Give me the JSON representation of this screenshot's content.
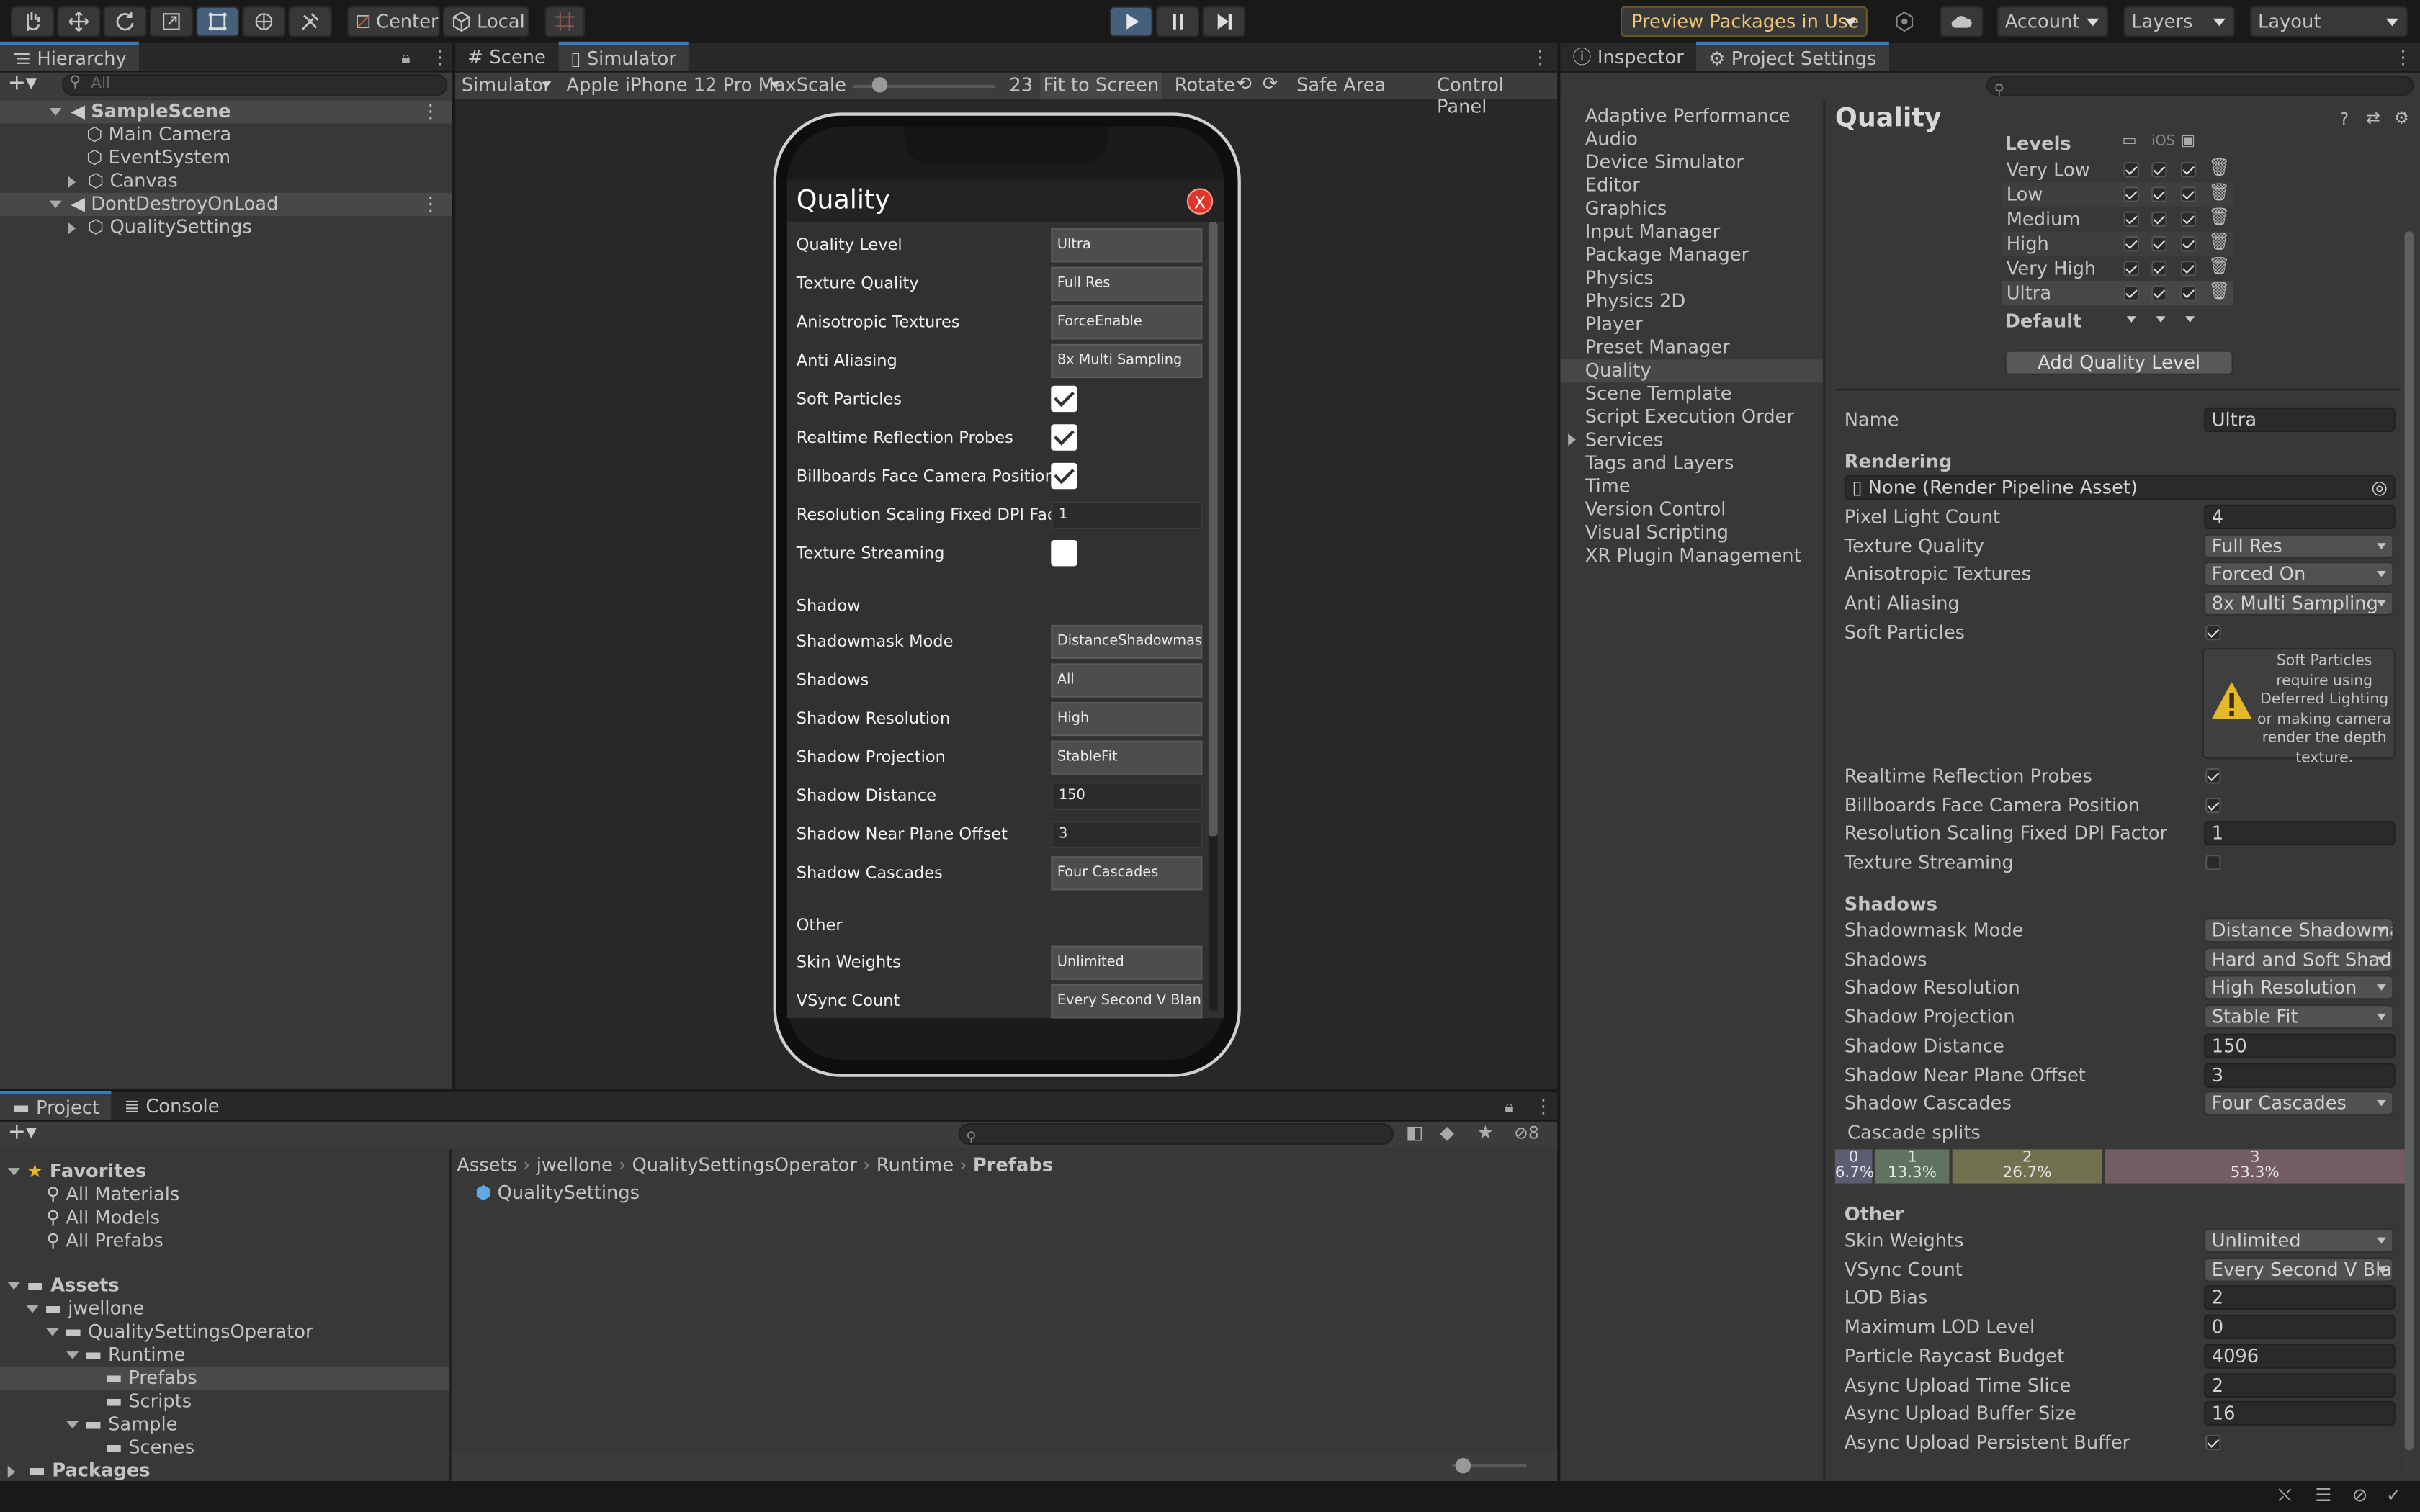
{
  "toolbar": {
    "center_label": "Center",
    "local_label": "Local",
    "preview_packages": "Preview Packages in Use",
    "account": "Account",
    "layers": "Layers",
    "layout": "Layout"
  },
  "hierarchy": {
    "tab": "Hierarchy",
    "search_placeholder": "All",
    "items": [
      "SampleScene",
      "Main Camera",
      "EventSystem",
      "Canvas",
      "DontDestroyOnLoad",
      "QualitySettings"
    ]
  },
  "scene_view": {
    "tabs": [
      "Scene",
      "Simulator"
    ],
    "simulator_label": "Simulator",
    "device": "Apple iPhone 12 Pro Max",
    "scale_label": "Scale",
    "scale_value": "23",
    "scale_fraction": 0.15,
    "fit_to_screen": "Fit to Screen",
    "rotate": "Rotate",
    "safe_area": "Safe Area",
    "control_panel": "Control Panel"
  },
  "phone": {
    "title": "Quality",
    "close": "X",
    "rows": [
      {
        "label": "Quality Level",
        "value": "Ultra"
      },
      {
        "label": "Texture Quality",
        "value": "Full Res"
      },
      {
        "label": "Anisotropic Textures",
        "value": "ForceEnable"
      },
      {
        "label": "Anti Aliasing",
        "value": "8x Multi Sampling"
      },
      {
        "label": "Soft Particles",
        "checked": true
      },
      {
        "label": "Realtime Reflection Probes",
        "checked": true
      },
      {
        "label": "Billboards Face Camera Position",
        "checked": true
      },
      {
        "label": "Resolution Scaling Fixed DPI Factor",
        "input": "1"
      },
      {
        "label": "Texture Streaming",
        "checked": false
      }
    ],
    "shadow_header": "Shadow",
    "shadow_rows": [
      {
        "label": "Shadowmask Mode",
        "value": "DistanceShadowmas"
      },
      {
        "label": "Shadows",
        "value": "All"
      },
      {
        "label": "Shadow Resolution",
        "value": "High"
      },
      {
        "label": "Shadow Projection",
        "value": "StableFit"
      },
      {
        "label": "Shadow Distance",
        "input": "150"
      },
      {
        "label": "Shadow Near Plane Offset",
        "input": "3"
      },
      {
        "label": "Shadow Cascades",
        "value": "Four Cascades"
      }
    ],
    "other_header": "Other",
    "other_rows": [
      {
        "label": "Skin Weights",
        "value": "Unlimited"
      },
      {
        "label": "VSync Count",
        "value": "Every Second V Blank"
      }
    ]
  },
  "project": {
    "tabs": [
      "Project",
      "Console"
    ],
    "badge": "8",
    "favorites_label": "Favorites",
    "favorites": [
      "All Materials",
      "All Models",
      "All Prefabs"
    ],
    "assets_label": "Assets",
    "tree": [
      "jwellone",
      "QualitySettingsOperator",
      "Runtime",
      "Prefabs",
      "Scripts",
      "Sample",
      "Scenes"
    ],
    "packages_label": "Packages",
    "breadcrumb": [
      "Assets",
      "jwellone",
      "QualitySettingsOperator",
      "Runtime",
      "Prefabs"
    ],
    "files": [
      "QualitySettings"
    ]
  },
  "inspector": {
    "tabs": [
      "Inspector",
      "Project Settings"
    ],
    "nav": [
      "Adaptive Performance",
      "Audio",
      "Device Simulator",
      "Editor",
      "Graphics",
      "Input Manager",
      "Package Manager",
      "Physics",
      "Physics 2D",
      "Player",
      "Preset Manager",
      "Quality",
      "Scene Template",
      "Script Execution Order",
      "Services",
      "Tags and Layers",
      "Time",
      "Version Control",
      "Visual Scripting",
      "XR Plugin Management"
    ],
    "title": "Quality",
    "levels_label": "Levels",
    "ios_label": "iOS",
    "levels": [
      "Very Low",
      "Low",
      "Medium",
      "High",
      "Very High",
      "Ultra"
    ],
    "default_label": "Default",
    "add_level": "Add Quality Level",
    "name_label": "Name",
    "name_value": "Ultra",
    "rendering_header": "Rendering",
    "pipeline_asset": "None (Render Pipeline Asset)",
    "rendering": [
      {
        "label": "Pixel Light Count",
        "field": "4"
      },
      {
        "label": "Texture Quality",
        "drop": "Full Res"
      },
      {
        "label": "Anisotropic Textures",
        "drop": "Forced On"
      },
      {
        "label": "Anti Aliasing",
        "drop": "8x Multi Sampling"
      },
      {
        "label": "Soft Particles",
        "check": true
      }
    ],
    "warning": "Soft Particles require using Deferred Lighting or making camera render the depth texture.",
    "rendering2": [
      {
        "label": "Realtime Reflection Probes",
        "check": true
      },
      {
        "label": "Billboards Face Camera Position",
        "check": true
      },
      {
        "label": "Resolution Scaling Fixed DPI Factor",
        "field": "1"
      },
      {
        "label": "Texture Streaming",
        "check": false
      }
    ],
    "shadows_header": "Shadows",
    "shadows": [
      {
        "label": "Shadowmask Mode",
        "drop": "Distance Shadowmask"
      },
      {
        "label": "Shadows",
        "drop": "Hard and Soft Shadows"
      },
      {
        "label": "Shadow Resolution",
        "drop": "High Resolution"
      },
      {
        "label": "Shadow Projection",
        "drop": "Stable Fit"
      },
      {
        "label": "Shadow Distance",
        "field": "150"
      },
      {
        "label": "Shadow Near Plane Offset",
        "field": "3"
      },
      {
        "label": "Shadow Cascades",
        "drop": "Four Cascades"
      }
    ],
    "cascade_label": "Cascade splits",
    "cascades": [
      {
        "index": "0",
        "percent": "6.7%",
        "fraction": 0.067,
        "color": "#5b5e73"
      },
      {
        "index": "1",
        "percent": "13.3%",
        "fraction": 0.133,
        "color": "#5f7360"
      },
      {
        "index": "2",
        "percent": "26.7%",
        "fraction": 0.267,
        "color": "#70714f"
      },
      {
        "index": "3",
        "percent": "53.3%",
        "fraction": 0.533,
        "color": "#735c62"
      }
    ],
    "other_header": "Other",
    "other": [
      {
        "label": "Skin Weights",
        "drop": "Unlimited"
      },
      {
        "label": "VSync Count",
        "drop": "Every Second V Blank"
      },
      {
        "label": "LOD Bias",
        "field": "2"
      },
      {
        "label": "Maximum LOD Level",
        "field": "0"
      },
      {
        "label": "Particle Raycast Budget",
        "field": "4096"
      },
      {
        "label": "Async Upload Time Slice",
        "field": "2"
      },
      {
        "label": "Async Upload Buffer Size",
        "field": "16"
      },
      {
        "label": "Async Upload Persistent Buffer",
        "check": true
      }
    ]
  },
  "colors": {
    "accent": "#3a79bb",
    "warning": "#e5b826",
    "close_red": "#e0342c"
  }
}
